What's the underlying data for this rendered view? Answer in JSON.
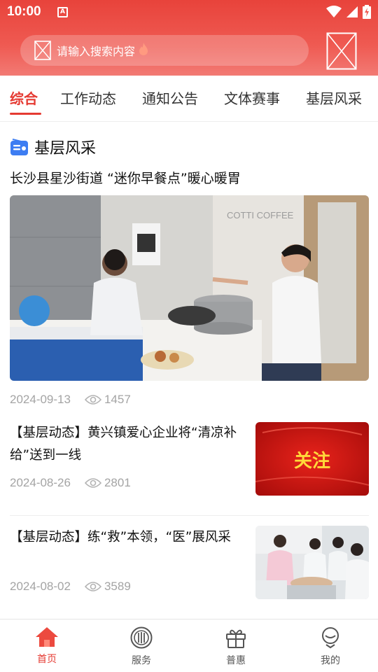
{
  "status_bar": {
    "time": "10:00",
    "notification_badge": "A"
  },
  "search": {
    "placeholder": "请输入搜索内容"
  },
  "tabs": [
    {
      "label": "综合",
      "active": true
    },
    {
      "label": "工作动态"
    },
    {
      "label": "通知公告"
    },
    {
      "label": "文体赛事"
    },
    {
      "label": "基层风采"
    }
  ],
  "section": {
    "title": "基层风采",
    "icon": "radio-icon"
  },
  "featured": {
    "title": "长沙县星沙街道 “迷你早餐点”暖心暖胃",
    "date": "2024-09-13",
    "views": "1457",
    "image_text": "COTTI COFFEE"
  },
  "articles": [
    {
      "title": "【基层动态】黄兴镇爱心企业将“清凉补给”送到一线",
      "date": "2024-08-26",
      "views": "2801",
      "thumb_text": "关注"
    },
    {
      "title": "【基层动态】练“救”本领，“医”展风采",
      "date": "2024-08-02",
      "views": "3589"
    }
  ],
  "bottom_nav": [
    {
      "label": "首页",
      "icon": "home-icon",
      "active": true
    },
    {
      "label": "服务",
      "icon": "service-icon"
    },
    {
      "label": "普惠",
      "icon": "gift-icon"
    },
    {
      "label": "我的",
      "icon": "profile-icon"
    }
  ],
  "colors": {
    "brand_red": "#e53a32",
    "muted": "#a4a4a4"
  }
}
